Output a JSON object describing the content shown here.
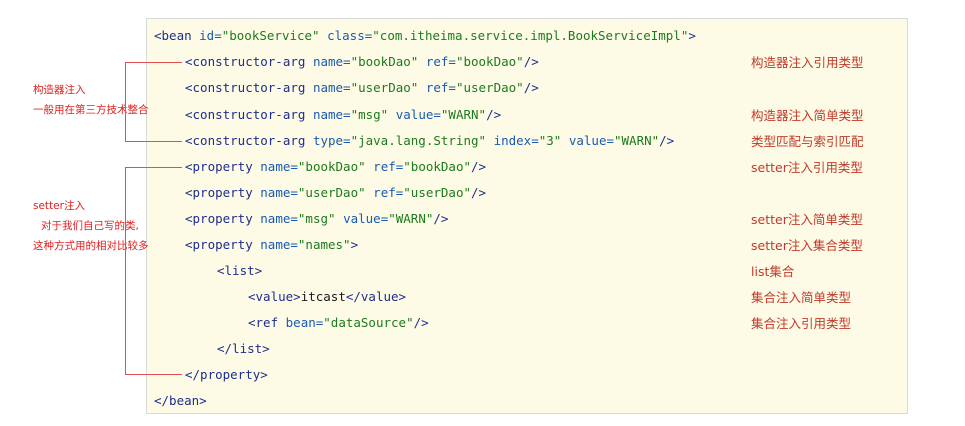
{
  "code_lines": [
    {
      "id": "bean-open",
      "parts": [
        [
          "tag",
          "<bean "
        ],
        [
          "attr",
          "id="
        ],
        [
          "val",
          "\"bookService\""
        ],
        [
          "attr",
          " class="
        ],
        [
          "val",
          "\"com.itheima.service.impl.BookServiceImpl\""
        ],
        [
          "tag",
          ">"
        ]
      ]
    },
    {
      "id": "ctor-bookdao",
      "parts": [
        [
          "tag",
          "<constructor-arg "
        ],
        [
          "attr",
          "name="
        ],
        [
          "val",
          "\"bookDao\""
        ],
        [
          "attr",
          " ref="
        ],
        [
          "val",
          "\"bookDao\""
        ],
        [
          "tag",
          "/>"
        ]
      ]
    },
    {
      "id": "ctor-userdao",
      "parts": [
        [
          "tag",
          "<constructor-arg "
        ],
        [
          "attr",
          "name="
        ],
        [
          "val",
          "\"userDao\""
        ],
        [
          "attr",
          " ref="
        ],
        [
          "val",
          "\"userDao\""
        ],
        [
          "tag",
          "/>"
        ]
      ]
    },
    {
      "id": "ctor-msg",
      "parts": [
        [
          "tag",
          "<constructor-arg "
        ],
        [
          "attr",
          "name="
        ],
        [
          "val",
          "\"msg\""
        ],
        [
          "attr",
          " value="
        ],
        [
          "val",
          "\"WARN\""
        ],
        [
          "tag",
          "/>"
        ]
      ]
    },
    {
      "id": "ctor-type",
      "parts": [
        [
          "tag",
          "<constructor-arg "
        ],
        [
          "attr",
          "type="
        ],
        [
          "val",
          "\"java.lang.String\""
        ],
        [
          "attr",
          " index="
        ],
        [
          "val",
          "\"3\""
        ],
        [
          "attr",
          " value="
        ],
        [
          "val",
          "\"WARN\""
        ],
        [
          "tag",
          "/>"
        ]
      ]
    },
    {
      "id": "prop-bookdao",
      "parts": [
        [
          "tag",
          "<property "
        ],
        [
          "attr",
          "name="
        ],
        [
          "val",
          "\"bookDao\""
        ],
        [
          "attr",
          " ref="
        ],
        [
          "val",
          "\"bookDao\""
        ],
        [
          "tag",
          "/>"
        ]
      ]
    },
    {
      "id": "prop-userdao",
      "parts": [
        [
          "tag",
          "<property "
        ],
        [
          "attr",
          "name="
        ],
        [
          "val",
          "\"userDao\""
        ],
        [
          "attr",
          " ref="
        ],
        [
          "val",
          "\"userDao\""
        ],
        [
          "tag",
          "/>"
        ]
      ]
    },
    {
      "id": "prop-msg",
      "parts": [
        [
          "tag",
          "<property "
        ],
        [
          "attr",
          "name="
        ],
        [
          "val",
          "\"msg\""
        ],
        [
          "attr",
          " value="
        ],
        [
          "val",
          "\"WARN\""
        ],
        [
          "tag",
          "/>"
        ]
      ]
    },
    {
      "id": "prop-names",
      "parts": [
        [
          "tag",
          "<property "
        ],
        [
          "attr",
          "name="
        ],
        [
          "val",
          "\"names\""
        ],
        [
          "tag",
          ">"
        ]
      ]
    },
    {
      "id": "list-open",
      "parts": [
        [
          "tag",
          "<list>"
        ]
      ]
    },
    {
      "id": "value-itcast",
      "parts": [
        [
          "tag",
          "<value>"
        ],
        [
          "txt",
          "itcast"
        ],
        [
          "tag",
          "</value>"
        ]
      ]
    },
    {
      "id": "ref-datasource",
      "parts": [
        [
          "tag",
          "<ref "
        ],
        [
          "attr",
          "bean="
        ],
        [
          "val",
          "\"dataSource\""
        ],
        [
          "tag",
          "/>"
        ]
      ]
    },
    {
      "id": "list-close",
      "parts": [
        [
          "tag",
          "</list>"
        ]
      ]
    },
    {
      "id": "property-close",
      "parts": [
        [
          "tag",
          "</property>"
        ]
      ]
    },
    {
      "id": "bean-close",
      "parts": [
        [
          "tag",
          "</bean>"
        ]
      ]
    }
  ],
  "right_notes": {
    "ctor_ref": "构造器注入引用类型",
    "ctor_simple": "构造器注入简单类型",
    "type_index": "类型匹配与索引匹配",
    "setter_ref": "setter注入引用类型",
    "setter_simple": "setter注入简单类型",
    "setter_collection": "setter注入集合类型",
    "list_collection": "list集合",
    "collection_simple": "集合注入简单类型",
    "collection_ref": "集合注入引用类型"
  },
  "left_notes": {
    "ctor_title": "构造器注入",
    "ctor_desc": "一般用在第三方技术整合",
    "setter_title": "setter注入",
    "setter_desc1": "对于我们自己写的类,",
    "setter_desc2": "这种方式用的相对比较多"
  },
  "colors": {
    "tag": "#1f2d8c",
    "attribute": "#1a5ab0",
    "value": "#1e7a1e",
    "note": "#c0392b",
    "bracket": "#e05050",
    "box_bg": "#fdfbe6"
  }
}
